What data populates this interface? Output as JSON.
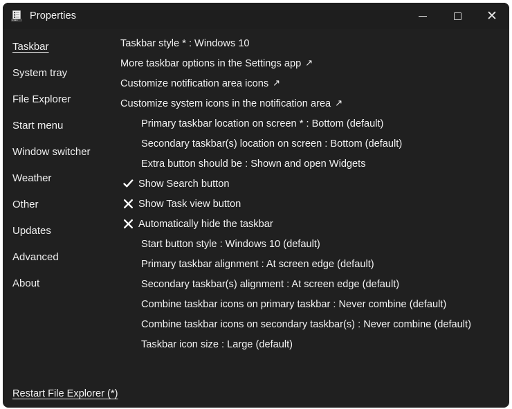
{
  "window": {
    "title": "Properties",
    "icon": "properties-app-icon",
    "background_color": "#202020",
    "titlebar_color": "#1e1e1e",
    "text_color": "#f2f2f2",
    "controls": [
      {
        "name": "minimize",
        "label": "—"
      },
      {
        "name": "maximize",
        "label": "□"
      },
      {
        "name": "close",
        "label": "✕"
      }
    ]
  },
  "sidebar": {
    "items": [
      {
        "label": "Taskbar",
        "active": true
      },
      {
        "label": "System tray",
        "active": false
      },
      {
        "label": "File Explorer",
        "active": false
      },
      {
        "label": "Start menu",
        "active": false
      },
      {
        "label": "Window switcher",
        "active": false
      },
      {
        "label": "Weather",
        "active": false
      },
      {
        "label": "Other",
        "active": false
      },
      {
        "label": "Updates",
        "active": false
      },
      {
        "label": "Advanced",
        "active": false
      },
      {
        "label": "About",
        "active": false
      }
    ]
  },
  "main": {
    "rows": [
      {
        "text": "Taskbar style * : Windows 10",
        "kind": "option",
        "indent": false,
        "mark": "none",
        "arrow": false
      },
      {
        "text": "More taskbar options in the Settings app",
        "kind": "link",
        "indent": false,
        "mark": "none",
        "arrow": true
      },
      {
        "text": "Customize notification area icons",
        "kind": "link",
        "indent": false,
        "mark": "none",
        "arrow": true
      },
      {
        "text": "Customize system icons in the notification area",
        "kind": "link",
        "indent": false,
        "mark": "none",
        "arrow": true
      },
      {
        "text": "Primary taskbar location on screen * : Bottom (default)",
        "kind": "option",
        "indent": true,
        "mark": "none",
        "arrow": false
      },
      {
        "text": "Secondary taskbar(s) location on screen : Bottom (default)",
        "kind": "option",
        "indent": true,
        "mark": "none",
        "arrow": false
      },
      {
        "text": "Extra button should be : Shown and open Widgets",
        "kind": "option",
        "indent": true,
        "mark": "none",
        "arrow": false
      },
      {
        "text": "Show Search button",
        "kind": "toggle",
        "indent": false,
        "mark": "check",
        "arrow": false
      },
      {
        "text": "Show Task view button",
        "kind": "toggle",
        "indent": false,
        "mark": "cross",
        "arrow": false
      },
      {
        "text": "Automatically hide the taskbar",
        "kind": "toggle",
        "indent": false,
        "mark": "cross",
        "arrow": false
      },
      {
        "text": "Start button style : Windows 10 (default)",
        "kind": "option",
        "indent": true,
        "mark": "none",
        "arrow": false
      },
      {
        "text": "Primary taskbar alignment : At screen edge (default)",
        "kind": "option",
        "indent": true,
        "mark": "none",
        "arrow": false
      },
      {
        "text": "Secondary taskbar(s) alignment : At screen edge (default)",
        "kind": "option",
        "indent": true,
        "mark": "none",
        "arrow": false
      },
      {
        "text": "Combine taskbar icons on primary taskbar : Never combine (default)",
        "kind": "option",
        "indent": true,
        "mark": "none",
        "arrow": false
      },
      {
        "text": "Combine taskbar icons on secondary taskbar(s) : Never combine (default)",
        "kind": "option",
        "indent": true,
        "mark": "none",
        "arrow": false
      },
      {
        "text": "Taskbar icon size : Large (default)",
        "kind": "option",
        "indent": true,
        "mark": "none",
        "arrow": false
      }
    ],
    "external_arrow_glyph": "↗"
  },
  "footer": {
    "restart_label": "Restart File Explorer (*)"
  }
}
